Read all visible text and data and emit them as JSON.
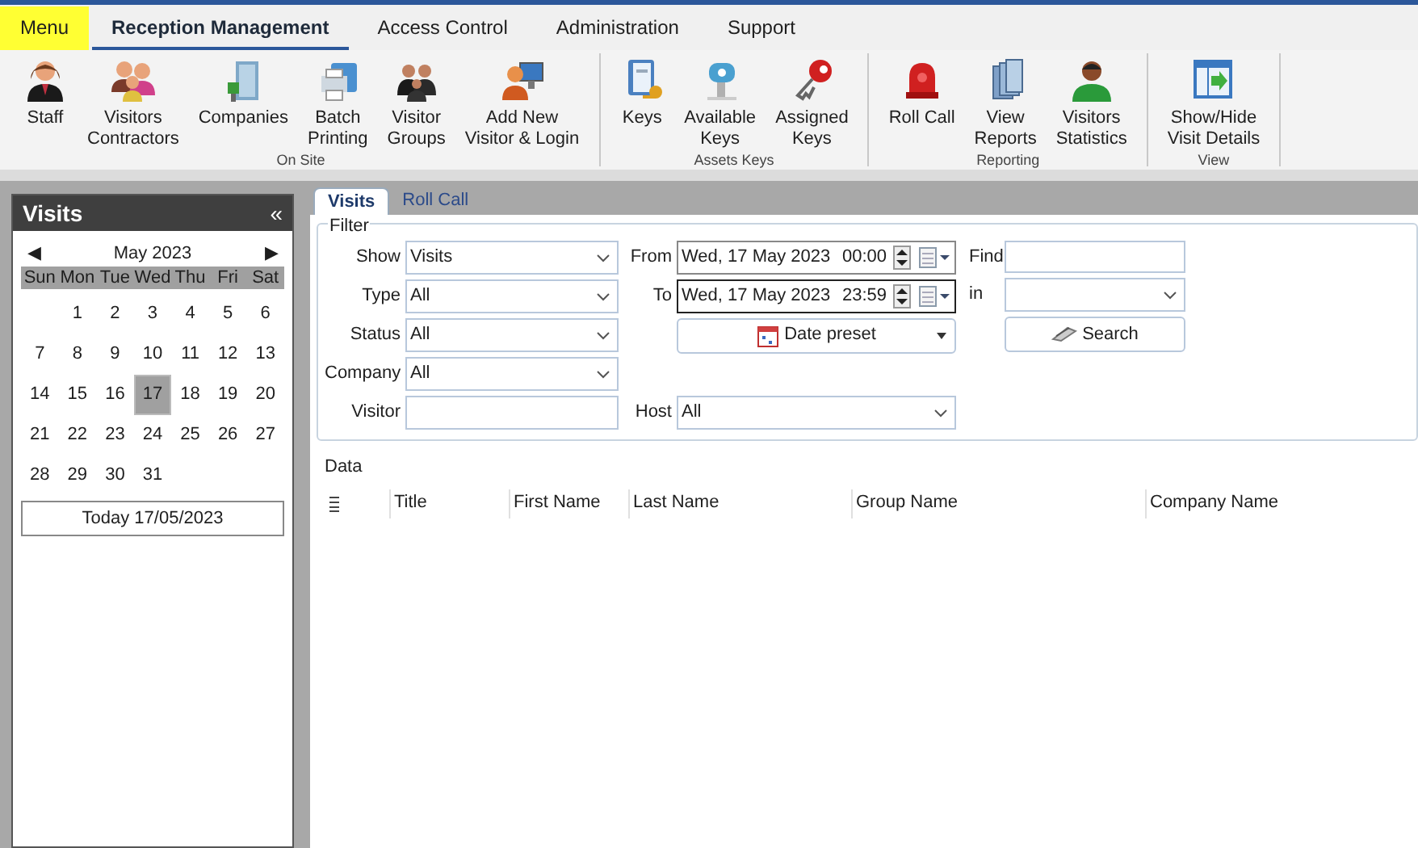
{
  "menu": [
    {
      "label": "Menu",
      "selected": false,
      "highlighted": true
    },
    {
      "label": "Reception Management",
      "selected": true,
      "highlighted": false
    },
    {
      "label": "Access Control",
      "selected": false,
      "highlighted": false
    },
    {
      "label": "Administration",
      "selected": false,
      "highlighted": false
    },
    {
      "label": "Support",
      "selected": false,
      "highlighted": false
    }
  ],
  "ribbon": [
    {
      "label": "On Site",
      "items": [
        {
          "label": "Staff"
        },
        {
          "label": "Visitors\nContractors"
        },
        {
          "label": "Companies"
        },
        {
          "label": "Batch\nPrinting"
        },
        {
          "label": "Visitor\nGroups"
        },
        {
          "label": "Add New\nVisitor & Login"
        }
      ]
    },
    {
      "label": "Assets Keys",
      "items": [
        {
          "label": "Keys"
        },
        {
          "label": "Available\nKeys"
        },
        {
          "label": "Assigned\nKeys"
        }
      ]
    },
    {
      "label": "Reporting",
      "items": [
        {
          "label": "Roll Call"
        },
        {
          "label": "View\nReports"
        },
        {
          "label": "Visitors\nStatistics"
        }
      ]
    },
    {
      "label": "View",
      "items": [
        {
          "label": "Show/Hide\nVisit Details"
        }
      ]
    }
  ],
  "side_panel": {
    "title": "Visits",
    "collapse": "«",
    "calendar": {
      "prev": "◀",
      "month": "May 2023",
      "next": "▶",
      "weekdays": [
        "Sun",
        "Mon",
        "Tue",
        "Wed",
        "Thu",
        "Fri",
        "Sat"
      ],
      "weeks": [
        [
          {
            "day": "1",
            "selected": false
          },
          {
            "day": "2",
            "selected": false
          },
          {
            "day": "3",
            "selected": false
          },
          {
            "day": "4",
            "selected": false
          },
          {
            "day": "5",
            "selected": false
          },
          {
            "day": "6",
            "selected": false
          }
        ],
        [
          {
            "day": "7",
            "selected": false
          },
          {
            "day": "8",
            "selected": false
          },
          {
            "day": "9",
            "selected": false
          },
          {
            "day": "10",
            "selected": false
          },
          {
            "day": "11",
            "selected": false
          },
          {
            "day": "12",
            "selected": false
          },
          {
            "day": "13",
            "selected": false
          }
        ],
        [
          {
            "day": "14",
            "selected": false
          },
          {
            "day": "15",
            "selected": false
          },
          {
            "day": "16",
            "selected": false
          },
          {
            "day": "17",
            "selected": true
          },
          {
            "day": "18",
            "selected": false
          },
          {
            "day": "19",
            "selected": false
          },
          {
            "day": "20",
            "selected": false
          }
        ],
        [
          {
            "day": "21",
            "selected": false
          },
          {
            "day": "22",
            "selected": false
          },
          {
            "day": "23",
            "selected": false
          },
          {
            "day": "24",
            "selected": false
          },
          {
            "day": "25",
            "selected": false
          },
          {
            "day": "26",
            "selected": false
          },
          {
            "day": "27",
            "selected": false
          }
        ],
        [
          {
            "day": "28",
            "selected": false
          },
          {
            "day": "29",
            "selected": false
          },
          {
            "day": "30",
            "selected": false
          },
          {
            "day": "31",
            "selected": false
          }
        ]
      ],
      "today_button": "Today 17/05/2023"
    }
  },
  "tabs": [
    {
      "label": "Visits",
      "selected": true
    },
    {
      "label": "Roll Call",
      "selected": false
    }
  ],
  "filter": {
    "title": "Filter",
    "left_fields": [
      {
        "label": "Show",
        "kind": "dropdown",
        "value": "Visits"
      },
      {
        "label": "Type",
        "kind": "dropdown",
        "value": "All"
      },
      {
        "label": "Status",
        "kind": "dropdown",
        "value": "All"
      },
      {
        "label": "Company",
        "kind": "dropdown",
        "value": "All"
      },
      {
        "label": "Visitor",
        "kind": "text"
      }
    ],
    "from": {
      "label": "From",
      "date": "Wed, 17 May 2023",
      "time": "00:00",
      "focused": false
    },
    "to": {
      "label": "To",
      "date": "Wed, 17 May 2023",
      "time": "23:59",
      "focused": true
    },
    "date_preset": "Date preset",
    "host": {
      "label": "Host",
      "value": "All"
    },
    "find": {
      "label": "Find"
    },
    "in": {
      "label": "in"
    },
    "search_button": "Search"
  },
  "data": {
    "title": "Data",
    "columns": [
      "Title",
      "First Name",
      "Last Name",
      "Group Name",
      "Company Name"
    ]
  }
}
